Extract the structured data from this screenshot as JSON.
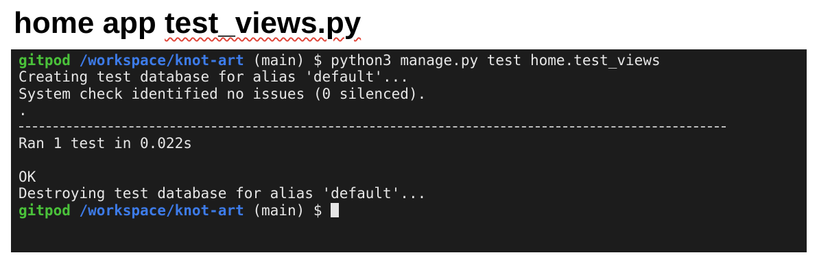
{
  "heading": {
    "prefix": "home app ",
    "filename": "test_views.py"
  },
  "terminal": {
    "prompt": {
      "user": "gitpod",
      "path": "/workspace/knot-art",
      "branch": " (main) $ "
    },
    "command": "python3 manage.py test home.test_views",
    "output": {
      "creating": "Creating test database for alias 'default'...",
      "system_check": "System check identified no issues (0 silenced).",
      "dot": ".",
      "ran": "Ran 1 test in 0.022s",
      "ok": "OK",
      "destroying": "Destroying test database for alias 'default'..."
    },
    "colors": {
      "background": "#1c1c1c",
      "user": "#4ac23a",
      "path": "#3d7be8",
      "text": "#e6e6e6"
    },
    "icons": {
      "cursor": "block-cursor-icon"
    }
  }
}
